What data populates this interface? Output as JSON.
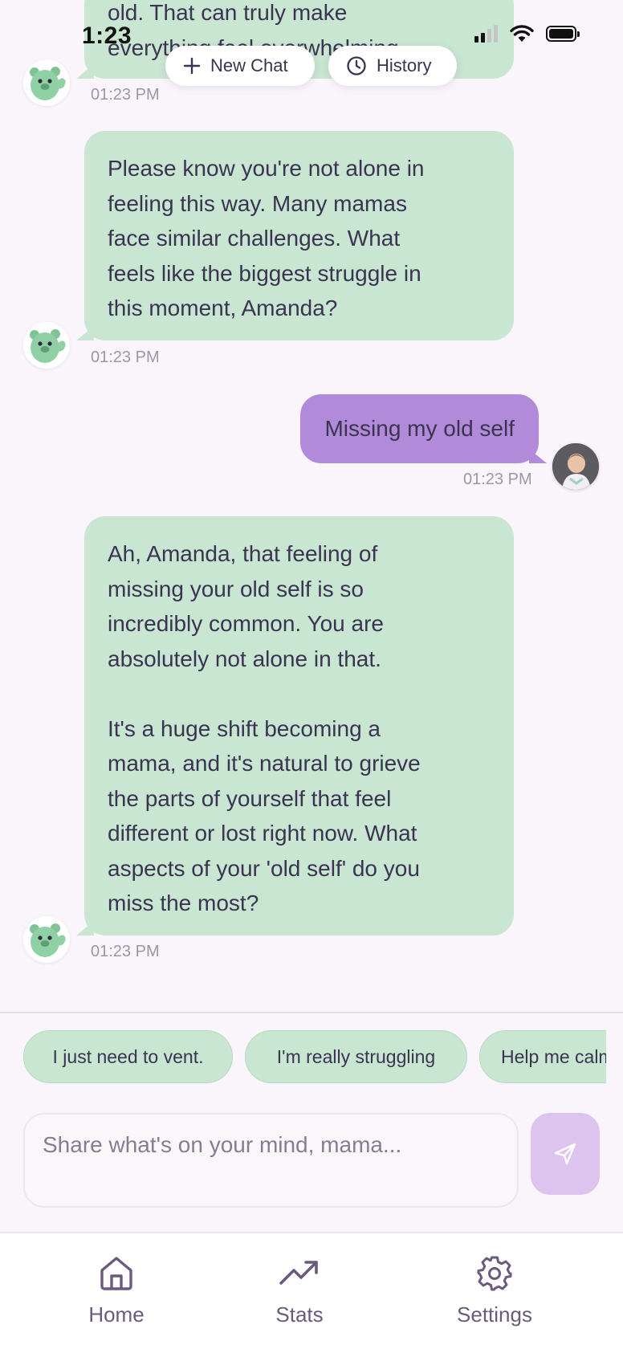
{
  "status_bar": {
    "time": "1:23"
  },
  "header": {
    "new_chat_label": "New Chat",
    "history_label": "History"
  },
  "messages": [
    {
      "role": "bot",
      "text": "old. That can truly make\neverything feel overwhelming",
      "time": "01:23 PM"
    },
    {
      "role": "bot",
      "text": "Please know you're not alone in\nfeeling this way. Many mamas\nface similar challenges. What\nfeels like the biggest struggle in\nthis moment, Amanda?",
      "time": "01:23 PM"
    },
    {
      "role": "user",
      "text": "Missing my old self",
      "time": "01:23 PM"
    },
    {
      "role": "bot",
      "text": "Ah, Amanda, that feeling of\nmissing your old self is so\nincredibly common. You are\nabsolutely not alone in that.\n\nIt's a huge shift becoming a\nmama, and it's natural to grieve\nthe parts of yourself that feel\ndifferent or lost right now. What\naspects of your 'old self' do you\nmiss the most?",
      "time": "01:23 PM"
    }
  ],
  "quick_replies": [
    "I just need to vent.",
    "I'm really struggling",
    "Help me calm down"
  ],
  "composer": {
    "placeholder": "Share what's on your mind, mama..."
  },
  "nav": {
    "home_label": "Home",
    "stats_label": "Stats",
    "settings_label": "Settings"
  },
  "colors": {
    "bot_bubble": "#c9e6d2",
    "user_bubble": "#b18bd9",
    "send_button": "#dcc4ee",
    "nav_icon": "#6a5a7c",
    "background": "#faf5fb"
  },
  "icons": [
    "plus-icon",
    "clock-icon",
    "send-icon",
    "home-icon",
    "trending-up-icon",
    "gear-icon",
    "bear-avatar",
    "user-avatar"
  ]
}
